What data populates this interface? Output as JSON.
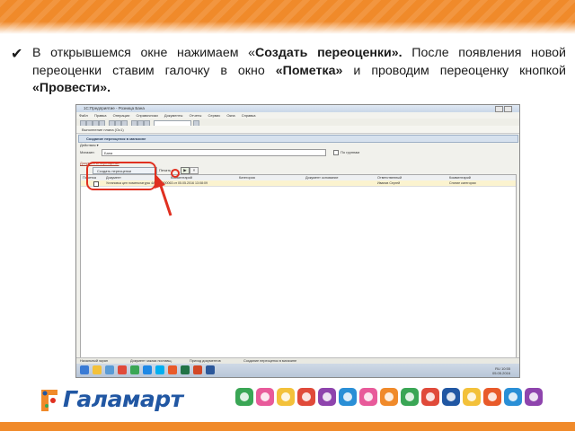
{
  "instruction": {
    "check_icon": "check-mark-icon",
    "part1": "В открывшемся окне нажимаем «",
    "bold1": "Создать переоценки».",
    "part2": " После появления новой переоценки ставим галочку в окно ",
    "bold2": "«Пометка»",
    "part3": " и проводим переоценку кнопкой ",
    "bold3": "«Провести»."
  },
  "screenshot": {
    "window_title": "1С:Предприятие - Розница Бана",
    "menu": [
      "Файл",
      "Правка",
      "Операции",
      "Справочники",
      "Документы",
      "Отчеты",
      "Сервис",
      "Окна",
      "Справка"
    ],
    "panel_title": "Выполнение плана (Ос1)",
    "inner_title": "Создание переоценок в магазине",
    "actions_label": "Действия ▾",
    "filter_label": "Магазин:",
    "filter_value": "Бана",
    "checkbox_label": "По группам",
    "documents_label": "Документы переоценки",
    "create_button": "Создать переоценки",
    "misc_label": "Печать ▾",
    "post_icon": "post-document-icon",
    "cancel_icon": "cancel-icon",
    "columns": [
      "Пометка",
      "Документ",
      "Комментарий",
      "Категория",
      "Документ основание",
      "Ответственный",
      "Комментарий"
    ],
    "row": {
      "document": "Установка цен номенклатуры 4A0000000063 от 05.05.2016 13:08:09",
      "responsible": "Иванов Сергей",
      "comment": "Снятие категории"
    },
    "window_tabs": [
      "Начальный экран",
      "Документ заказа поставщ.",
      "Приход документов",
      "Создание переоценок в магазине"
    ],
    "clock_time": "10:55",
    "clock_date": "05.05.2016",
    "language": "RU"
  },
  "branding": {
    "logo_text": "Галамарт",
    "logo_icon": "galamart-logo-icon",
    "category_icons": [
      "toys-icon",
      "household-icon",
      "kitchen-icon",
      "tools-icon",
      "garden-icon",
      "stationery-icon",
      "sports-icon",
      "gifts-icon",
      "textile-icon",
      "party-icon",
      "crafts-icon",
      "decor-icon",
      "pets-icon",
      "beauty-icon",
      "seasonal-icon",
      "sale-icon"
    ]
  },
  "colors": {
    "brand_orange": "#f08a2a",
    "brand_blue": "#2157a3",
    "highlight_red": "#e03020"
  }
}
